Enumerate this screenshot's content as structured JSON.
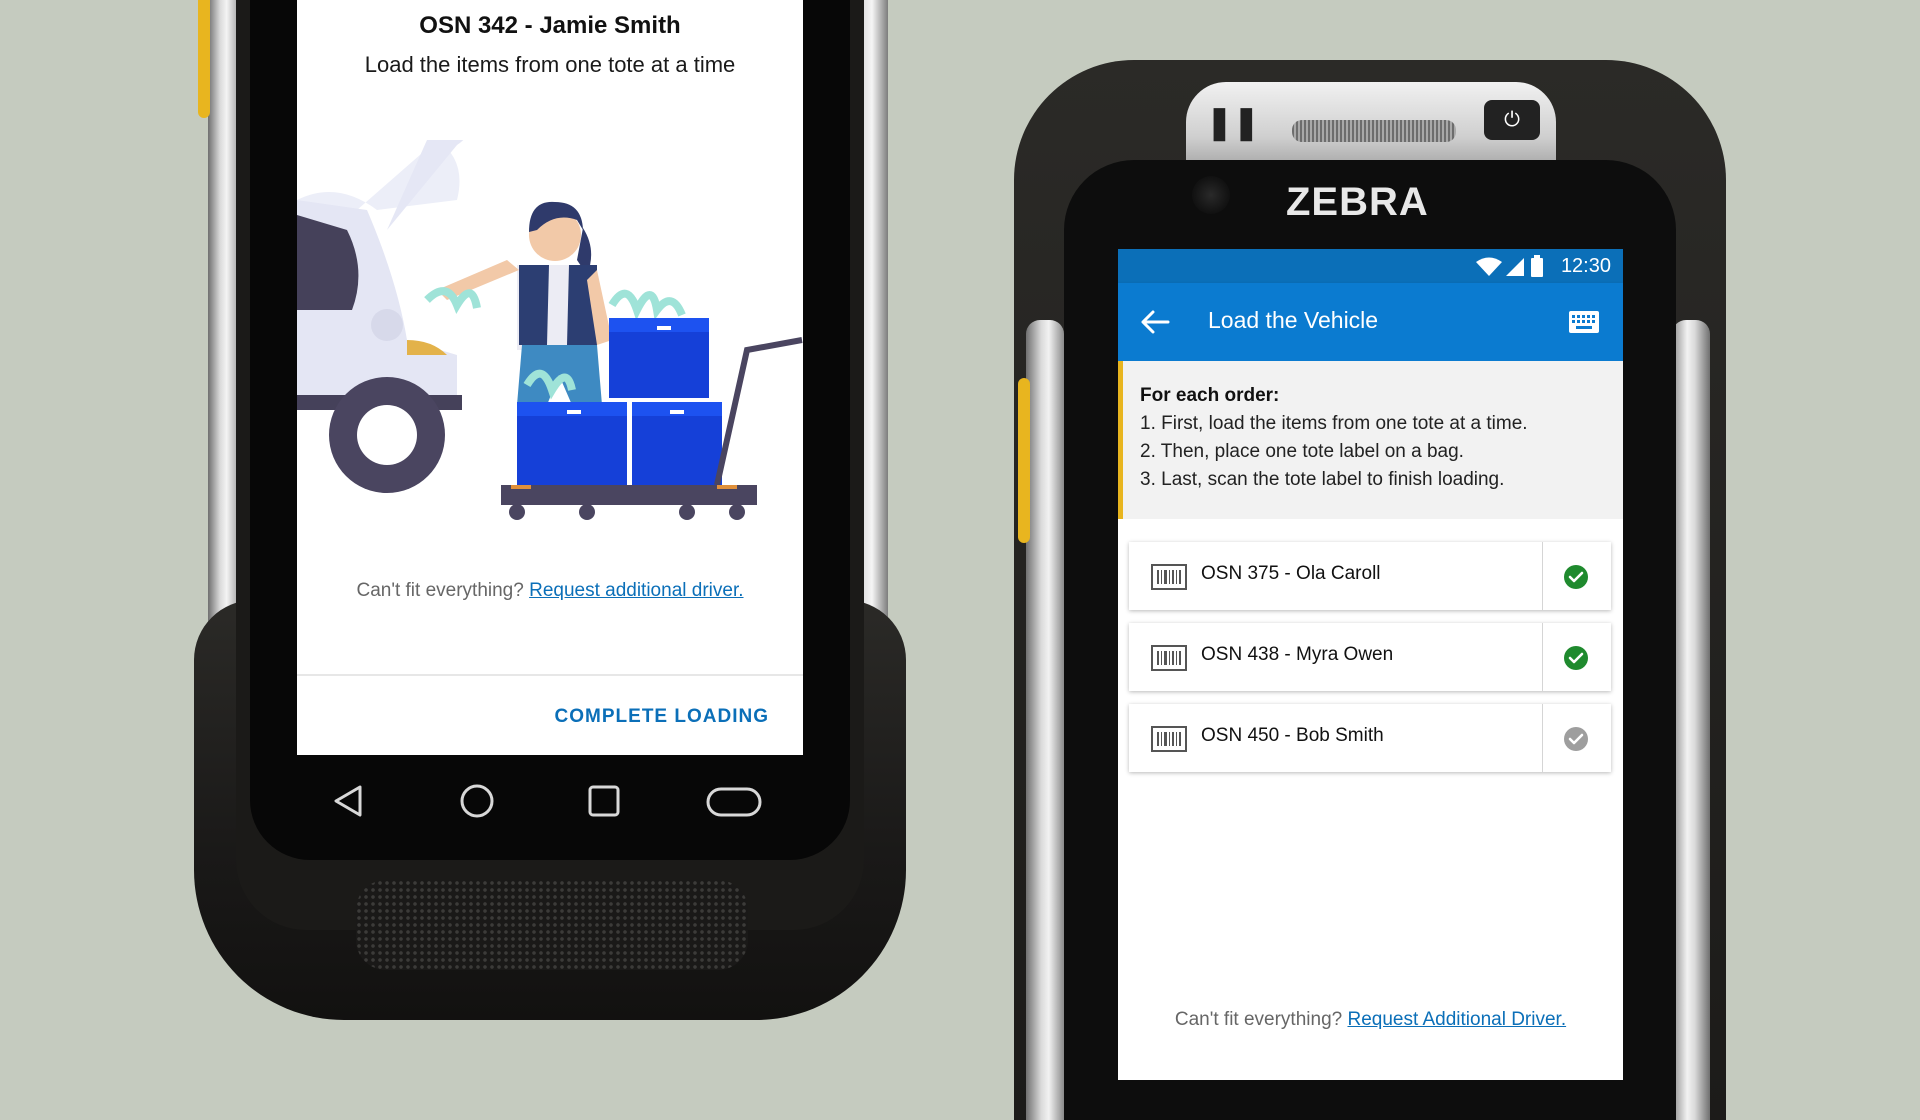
{
  "left_screen": {
    "title": "OSN 342 - Jamie Smith",
    "subtitle": "Load the items from one tote at a time",
    "cant_fit_text": "Can't fit everything?",
    "request_driver_link": "Request additional driver.",
    "complete_button": "COMPLETE LOADING",
    "nav_icons": [
      "back-triangle-icon",
      "home-circle-icon",
      "recents-square-icon",
      "pill-icon"
    ]
  },
  "right_device": {
    "brand": "ZEBRA",
    "status_bar": {
      "time": "12:30",
      "icons": [
        "wifi-icon",
        "signal-icon",
        "battery-icon"
      ]
    },
    "app_bar": {
      "title": "Load the Vehicle",
      "back_icon": "arrow-back-icon",
      "action_icon": "keyboard-icon"
    },
    "instructions": {
      "heading": "For each order:",
      "steps": [
        "1. First, load the items from one tote at a time.",
        "2. Then, place one tote label on a bag.",
        "3. Last, scan the tote label to finish loading."
      ]
    },
    "orders": [
      {
        "label": "OSN 375 - Ola Caroll",
        "status": "complete"
      },
      {
        "label": "OSN 438 - Myra Owen",
        "status": "complete"
      },
      {
        "label": "OSN 450 - Bob Smith",
        "status": "pending"
      }
    ],
    "cant_fit_text": "Can't fit everything?",
    "request_driver_link": "Request Additional Driver."
  },
  "colors": {
    "background": "#c5cbbf",
    "primary_blue": "#0b7bd0",
    "link_blue": "#0b6fb8",
    "accent_yellow": "#e8b51f",
    "check_green": "#1f8a2e",
    "check_grey": "#9e9e9e"
  }
}
